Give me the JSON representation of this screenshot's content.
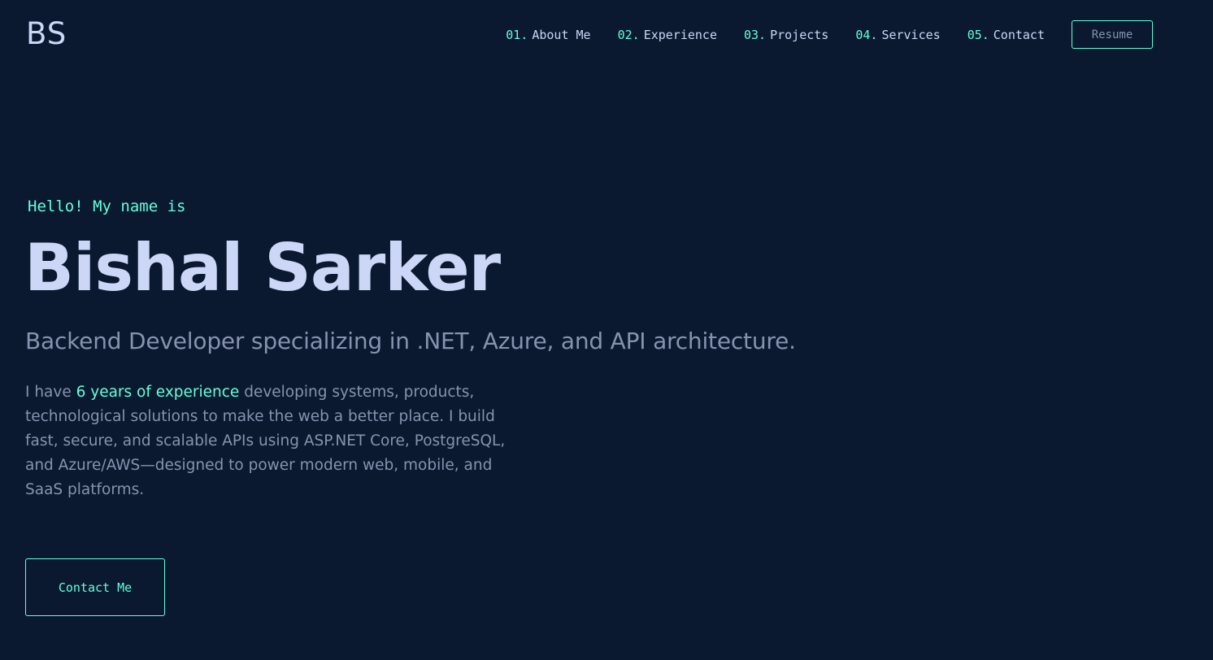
{
  "brand": {
    "logo": "BS"
  },
  "nav": {
    "items": [
      {
        "num": "01.",
        "label": "About Me"
      },
      {
        "num": "02.",
        "label": "Experience"
      },
      {
        "num": "03.",
        "label": "Projects"
      },
      {
        "num": "04.",
        "label": "Services"
      },
      {
        "num": "05.",
        "label": "Contact"
      }
    ],
    "resume_label": "Resume"
  },
  "hero": {
    "greeting": "Hello! My name is",
    "name": "Bishal Sarker",
    "tagline": "Backend Developer specializing in .NET, Azure, and API architecture.",
    "bio_before": "I have ",
    "bio_highlight": "6 years of experience",
    "bio_after": " developing systems, products, technological solutions to make the web a better place. I build fast, secure, and scalable APIs using ASP.NET Core, PostgreSQL, and Azure/AWS—designed to power modern web, mobile, and SaaS platforms.",
    "contact_label": "Contact Me"
  },
  "colors": {
    "background": "#0a192f",
    "accent": "#64ffda",
    "heading": "#ccd6f6",
    "body": "#8892b0"
  }
}
